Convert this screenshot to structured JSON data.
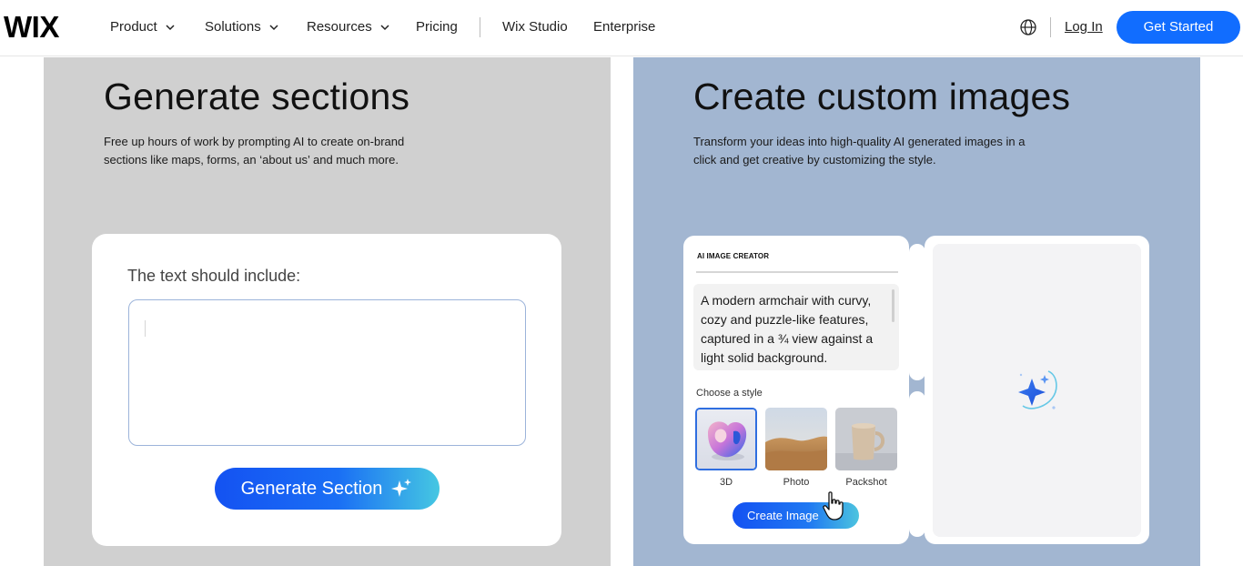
{
  "nav": {
    "logo": "WIX",
    "items": [
      {
        "label": "Product",
        "has_dropdown": true
      },
      {
        "label": "Solutions",
        "has_dropdown": true
      },
      {
        "label": "Resources",
        "has_dropdown": true
      },
      {
        "label": "Pricing",
        "has_dropdown": false
      },
      {
        "label": "Wix Studio",
        "has_dropdown": false
      },
      {
        "label": "Enterprise",
        "has_dropdown": false
      }
    ],
    "globe_icon": "globe-icon",
    "login": "Log In",
    "cta": "Get Started"
  },
  "left": {
    "title": "Generate sections",
    "description": "Free up hours of work by prompting AI to create on-brand sections like maps, forms, an ‘about us’ and much more.",
    "card_label": "The text should include:",
    "textarea_value": "",
    "button": "Generate Section"
  },
  "right": {
    "title": "Create custom images",
    "description": "Transform your ideas into high-quality AI generated images in a click and get creative by customizing the style.",
    "ai_card_title": "AI IMAGE CREATOR",
    "prompt": "A modern armchair with curvy, cozy and puzzle-like features, captured in a ¾ view against a light solid background.",
    "style_label": "Choose a style",
    "styles": [
      {
        "label": "3D",
        "selected": true
      },
      {
        "label": "Photo",
        "selected": false
      },
      {
        "label": "Packshot",
        "selected": false
      }
    ],
    "button": "Create Image"
  },
  "colors": {
    "brand_blue": "#116dff",
    "left_panel_bg": "#d0d0d0",
    "right_panel_bg": "#a2b6d1"
  }
}
